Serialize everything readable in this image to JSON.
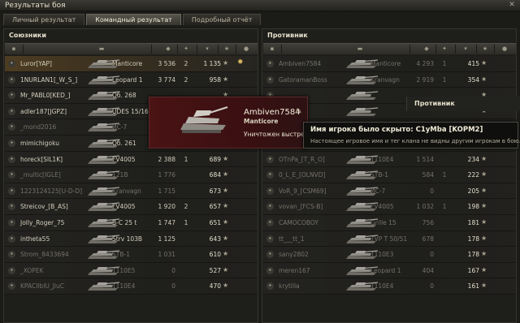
{
  "window": {
    "title": "Результаты боя"
  },
  "tabs": [
    {
      "label": "Личный результат",
      "active": false
    },
    {
      "label": "Командный результат",
      "active": true
    },
    {
      "label": "Подробный отчёт",
      "active": false
    }
  ],
  "left": {
    "title": "Союзники",
    "rows": [
      {
        "player": "Luror[YAP]",
        "tank": "Manticore",
        "damage": "3 536",
        "frags": "2",
        "xp": "1 135",
        "mine": true,
        "dead": false
      },
      {
        "player": "1NURLAN1[_W_S_]",
        "tank": "Leopard 1",
        "damage": "3 774",
        "frags": "2",
        "xp": "958",
        "mine": false,
        "dead": false
      },
      {
        "player": "Mr_PABL0[KED_]",
        "tank": "Об. 268",
        "damage": "",
        "frags": "",
        "xp": "",
        "mine": false,
        "dead": false
      },
      {
        "player": "adler187[JGPZ]",
        "tank": "UDES 15/16",
        "damage": "",
        "frags": "",
        "xp": "",
        "mine": false,
        "dead": false
      },
      {
        "player": "_mond2016",
        "tank": "ИС-7",
        "damage": "",
        "frags": "",
        "xp": "",
        "mine": false,
        "dead": true
      },
      {
        "player": "mimichigoku",
        "tank": "Об. 261",
        "damage": "",
        "frags": "",
        "xp": "",
        "mine": false,
        "dead": false
      },
      {
        "player": "horeck[SIL1K]",
        "tank": "FV4005",
        "damage": "2 388",
        "frags": "1",
        "xp": "689",
        "mine": false,
        "dead": false
      },
      {
        "player": "_multic[IGLE]",
        "tank": "121B",
        "damage": "1 776",
        "frags": "",
        "xp": "684",
        "mine": false,
        "dead": true
      },
      {
        "player": "1223124125[U-D-D]",
        "tank": "Kranvagn",
        "damage": "1 715",
        "frags": "",
        "xp": "673",
        "mine": false,
        "dead": true
      },
      {
        "player": "Streicov_[B_AS]",
        "tank": "FV4005",
        "damage": "1 920",
        "frags": "2",
        "xp": "657",
        "mine": false,
        "dead": false
      },
      {
        "player": "Jolly_Roger_75",
        "tank": "B-C 25 t",
        "damage": "1 747",
        "frags": "1",
        "xp": "651",
        "mine": false,
        "dead": false
      },
      {
        "player": "intheta55",
        "tank": "Strv 103B",
        "damage": "1 125",
        "frags": "",
        "xp": "643",
        "mine": false,
        "dead": false
      },
      {
        "player": "Strom_8433694",
        "tank": "STB-1",
        "damage": "1 031",
        "frags": "",
        "xp": "610",
        "mine": false,
        "dead": true
      },
      {
        "player": "_XOPEK",
        "tank": "T110E5",
        "damage": "0",
        "frags": "",
        "xp": "527",
        "mine": false,
        "dead": true
      },
      {
        "player": "KPACIlbIU_JluC",
        "tank": "T110E4",
        "damage": "0",
        "frags": "",
        "xp": "470",
        "mine": false,
        "dead": true
      }
    ]
  },
  "right": {
    "title": "Противник",
    "rows": [
      {
        "player": "Ambiven7584",
        "tank": "Manticore",
        "damage": "4 293",
        "frags": "1",
        "xp": "415",
        "dead": true
      },
      {
        "player": "GatoramanBoss",
        "tank": "Kranvagn",
        "damage": "2 919",
        "frags": "1",
        "xp": "354",
        "dead": true
      },
      {
        "player": "",
        "tank": "",
        "damage": "",
        "frags": "",
        "xp": "",
        "dead": true
      },
      {
        "player": "",
        "tank": "",
        "damage": "",
        "frags": "",
        "xp": "",
        "dead": true
      },
      {
        "player": "",
        "tank": "",
        "damage": "",
        "frags": "",
        "xp": "",
        "dead": true
      },
      {
        "player": "",
        "tank": "",
        "damage": "",
        "frags": "",
        "xp": "",
        "dead": true
      },
      {
        "player": "OTnPa_[T_R_O]",
        "tank": "T110E4",
        "damage": "1 514",
        "frags": "",
        "xp": "234",
        "dead": true
      },
      {
        "player": "0_L_E_[OLNVD]",
        "tank": "STB-1",
        "damage": "584",
        "frags": "1",
        "xp": "222",
        "dead": true
      },
      {
        "player": "VoR_9_[CSM69]",
        "tank": "ИС-7",
        "damage": "0",
        "frags": "",
        "xp": "205",
        "dead": true
      },
      {
        "player": "vovan_[FCS-B]",
        "tank": "FV4005",
        "damage": "1 032",
        "frags": "1",
        "xp": "198",
        "dead": true
      },
      {
        "player": "CAMOCOBOY",
        "tank": "Grille 15",
        "damage": "756",
        "frags": "",
        "xp": "181",
        "dead": true
      },
      {
        "player": "tt___tt_1",
        "tank": "TVP T 50/51",
        "damage": "678",
        "frags": "",
        "xp": "178",
        "dead": true
      },
      {
        "player": "sany2802",
        "tank": "T110E3",
        "damage": "0",
        "frags": "",
        "xp": "178",
        "dead": true
      },
      {
        "player": "meren167",
        "tank": "Leopard 1",
        "damage": "404",
        "frags": "",
        "xp": "167",
        "dead": true
      },
      {
        "player": "krytilla",
        "tank": "T110E4",
        "damage": "0",
        "frags": "",
        "xp": "161",
        "dead": true
      }
    ]
  },
  "tooltip": {
    "player": "Ambiven7584",
    "tank": "Manticore",
    "status": "Уничтожен выстрелом"
  },
  "hidden_tip": {
    "title": "Имя игрока было скрыто: C1yMba [KOPM2]",
    "desc": "Настоящее игровое имя и тег клана не видны другим игрокам в бою."
  },
  "enemy_sub_title": "Противник",
  "icons": {
    "close": "close-icon",
    "star": "star-icon",
    "medal": "medal-icon",
    "mask": "anonymizer-icon"
  }
}
